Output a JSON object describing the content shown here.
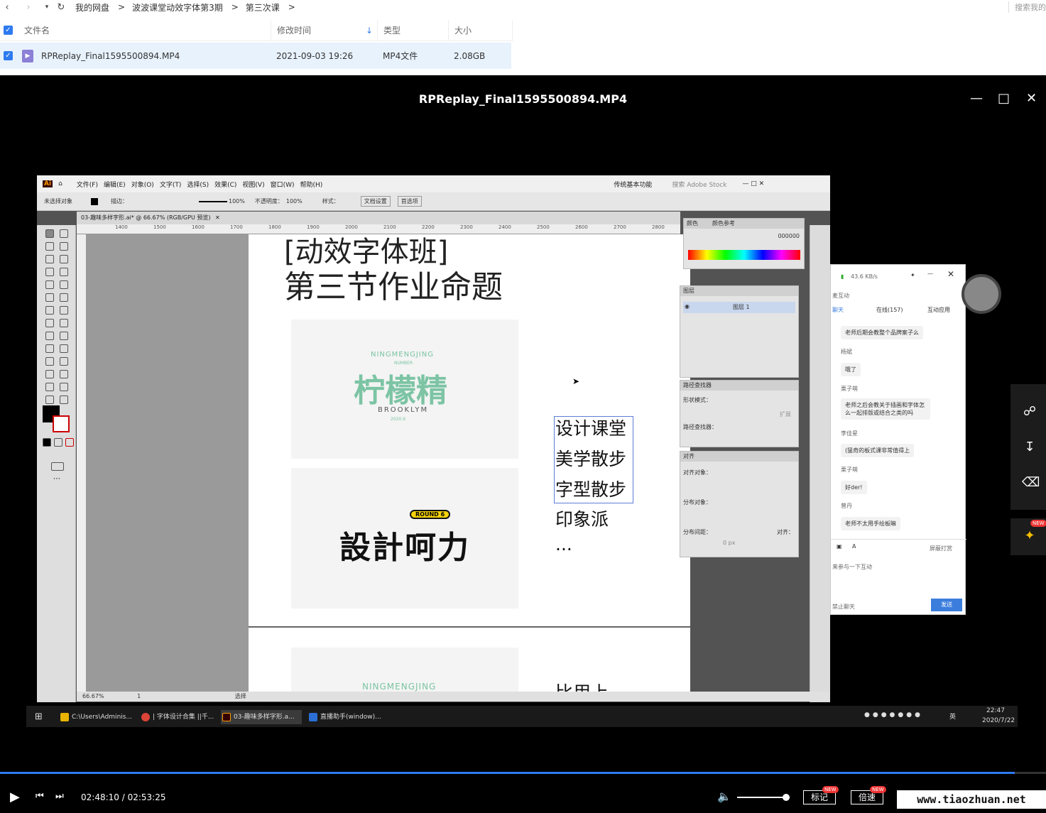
{
  "explorer": {
    "breadcrumb": [
      "我的网盘",
      "波波课堂动效字体第3期",
      "第三次课"
    ],
    "search_placeholder": "搜索我的",
    "columns": [
      "文件名",
      "修改时间",
      "类型",
      "大小"
    ],
    "file": {
      "name": "RPReplay_Final1595500894.MP4",
      "modified": "2021-09-03 19:26",
      "type": "MP4文件",
      "size": "2.08GB"
    }
  },
  "player": {
    "title": "RPReplay_Final1595500894.MP4",
    "current_time": "02:48:10",
    "duration": "02:53:25",
    "time_sep": " / ",
    "progress": 0.97,
    "volume": 0.93,
    "mark_label": "标记",
    "speed_label": "倍速",
    "new_badge": "NEW",
    "watermark": "www.tiaozhuan.net"
  },
  "illustrator": {
    "menu": [
      "文件(F)",
      "编辑(E)",
      "对象(O)",
      "文字(T)",
      "选择(S)",
      "效果(C)",
      "视图(V)",
      "窗口(W)",
      "帮助(H)"
    ],
    "workspace": "传统基本功能",
    "search_stock": "搜索 Adobe Stock",
    "ctrl": {
      "no_selection": "未选择对象",
      "stroke": "描边：",
      "pct": "100%",
      "opacity_label": "不透明度：",
      "opacity": "100%",
      "style": "样式：",
      "doc_setup": "文档设置",
      "prefs": "首选项"
    },
    "doc_tab": "03-趣味多样字形.ai* @ 66.67% (RGB/GPU 预览)",
    "zoom": "66.67%",
    "page": "1",
    "status": "选择",
    "ruler": [
      "1400",
      "1500",
      "1600",
      "1700",
      "1800",
      "1900",
      "2000",
      "2100",
      "2200",
      "2300",
      "2400",
      "2500",
      "2600",
      "2700",
      "2800"
    ],
    "artboard": {
      "title_line1": "[动效字体班]",
      "title_line2": "第三节作业命题",
      "card1_top": "NINGMENGJING",
      "card1_sub": "NUMBER",
      "card1_main": "柠檬精",
      "card1_bottom": "BROOKLYM",
      "card1_year": "2020.6",
      "card2_badge": "ROUND 6",
      "card2_main": "設計呵力",
      "list": [
        "设计课堂",
        "美学散步",
        "字型散步",
        "印象派",
        "..."
      ],
      "card3_top": "NINGMENGJING",
      "bottom_partial": "比用上"
    },
    "panels": {
      "color": {
        "tab1": "颜色",
        "tab2": "颜色参考",
        "hex": "000000"
      },
      "layers": {
        "title": "图层",
        "layer_name": "图层 1"
      },
      "pathfinder": {
        "title": "路径查找器",
        "shape_modes": "形状模式：",
        "expand": "扩展",
        "pathfinders": "路径查找器："
      },
      "align": {
        "title": "对齐",
        "align_objects": "对齐对象：",
        "distribute_objects": "分布对象：",
        "distribute_spacing": "分布间距：",
        "align_to": "对齐：",
        "spacing_value": "0 px"
      }
    }
  },
  "chat": {
    "speed": "43.6 KB/s",
    "room": "麦互动",
    "tabs": [
      "聊天",
      "在线(157)",
      "互动应用"
    ],
    "messages": [
      {
        "user": "",
        "text": "老师后期会教整个品牌案子么"
      },
      {
        "user": "杨斌",
        "text": "哦了"
      },
      {
        "user": "栗子萌",
        "text": "老师之后会教关于插画和字体怎么一起排版或结合之类的吗"
      },
      {
        "user": "李佳星",
        "text": "(猛奇的板式课非常值得上"
      },
      {
        "user": "栗子萌",
        "text": "好der!"
      },
      {
        "user": "曾丹",
        "text": "老师不太用手绘板嘛"
      }
    ],
    "block_tips": "屏蔽打赏",
    "input_placeholder": "来参与一下互动",
    "disable_chat": "禁止聊天",
    "send": "发送"
  },
  "taskbar": {
    "items": [
      "C:\\Users\\Adminis...",
      "| 字体设计合集 ||千...",
      "03-趣味多样字形.a...",
      "直播助手(window)..."
    ],
    "ime": "英",
    "time": "22:47",
    "date": "2020/7/22"
  },
  "colors": {
    "accent": "#2e7bf0",
    "mint": "#7cc4a4",
    "badge_yellow": "#f5d20a"
  }
}
